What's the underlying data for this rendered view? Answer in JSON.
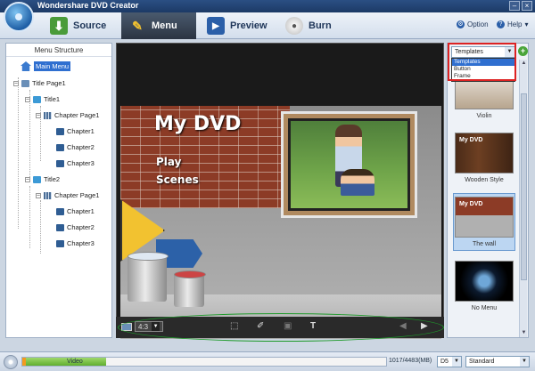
{
  "app": {
    "title": "Wondershare DVD Creator"
  },
  "toolbar": {
    "tabs": [
      {
        "label": "Source"
      },
      {
        "label": "Menu"
      },
      {
        "label": "Preview"
      },
      {
        "label": "Burn"
      }
    ],
    "option_label": "Option",
    "help_label": "Help"
  },
  "menu_structure": {
    "header": "Menu Structure",
    "nodes": [
      {
        "label": "Main Menu"
      },
      {
        "label": "Title Page1"
      },
      {
        "label": "Title1"
      },
      {
        "label": "Chapter Page1"
      },
      {
        "label": "Chapter1"
      },
      {
        "label": "Chapter2"
      },
      {
        "label": "Chapter3"
      },
      {
        "label": "Title2"
      },
      {
        "label": "Chapter Page1"
      },
      {
        "label": "Chapter1"
      },
      {
        "label": "Chapter2"
      },
      {
        "label": "Chapter3"
      }
    ]
  },
  "preview": {
    "title": "My DVD",
    "items": [
      "Play",
      "Scenes"
    ],
    "aspect_ratio": "4:3"
  },
  "templates": {
    "selected": "Templates",
    "options": [
      "Templates",
      "Button",
      "Frame"
    ],
    "cards": [
      {
        "label": "Violin"
      },
      {
        "label": "Wooden Style",
        "thumb_text": "My DVD"
      },
      {
        "label": "The wall",
        "thumb_text": "My DVD"
      },
      {
        "label": "No Menu"
      }
    ]
  },
  "status": {
    "progress_label": "Video",
    "progress_fraction": 0.23,
    "size_text": "1017/4483(MB)",
    "disc_type": "D5",
    "quality": "Standard"
  }
}
